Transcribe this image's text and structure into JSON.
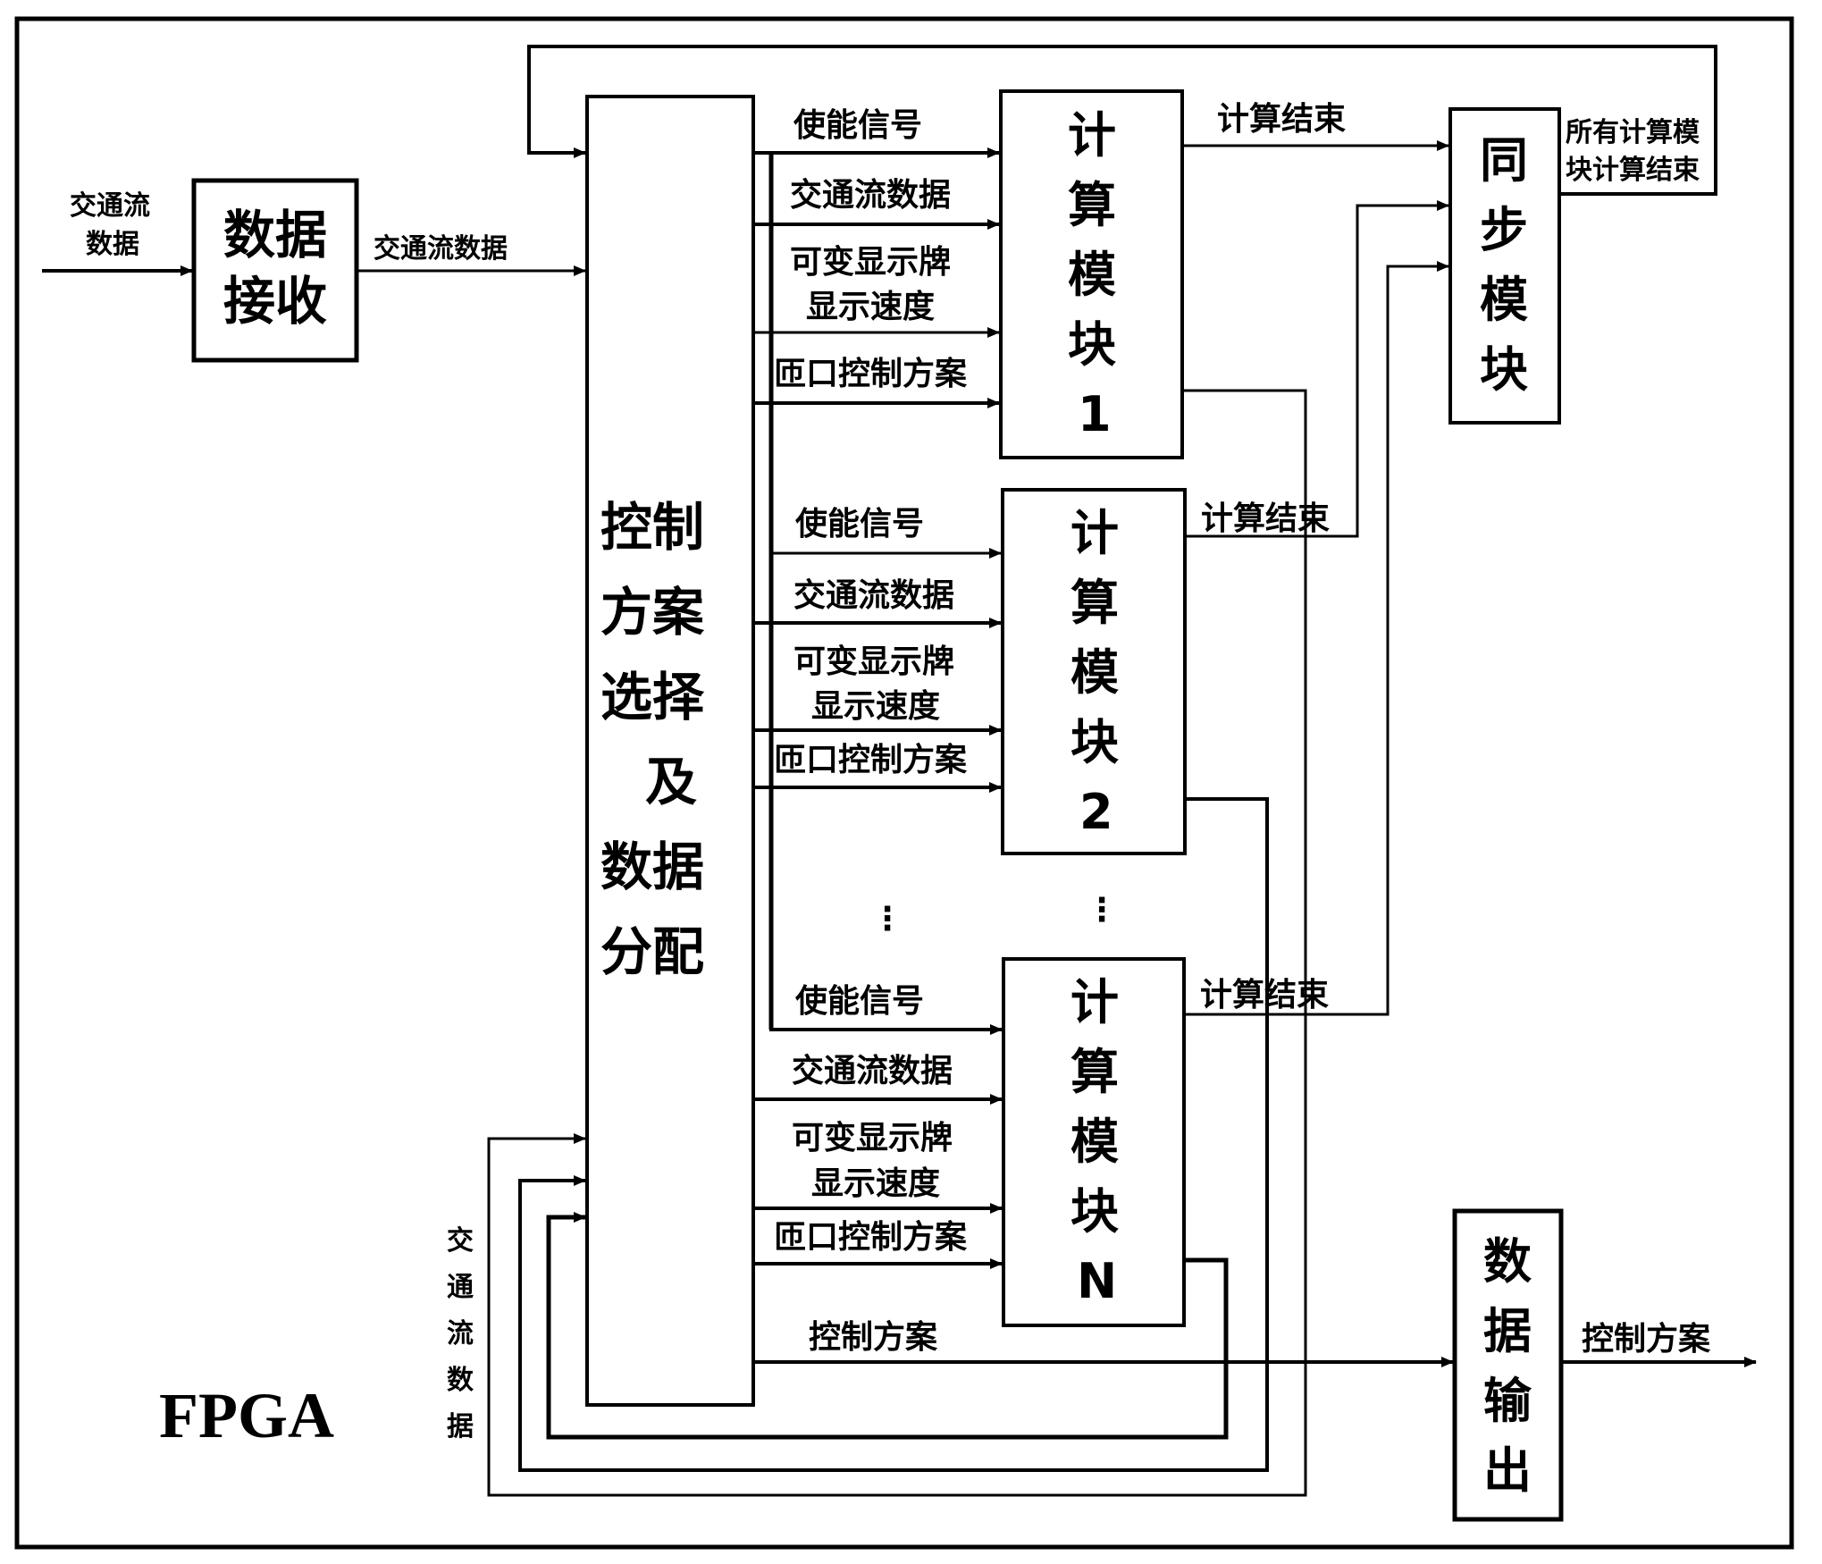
{
  "diagram": {
    "container_label": "FPGA",
    "input_label": [
      "交通流",
      "数据"
    ],
    "blocks": {
      "data_receive": [
        "数据",
        "接收"
      ],
      "control_select": [
        "控制",
        "方案",
        "选择",
        "及",
        "数据",
        "分配"
      ],
      "sync": [
        "同",
        "步",
        "模",
        "块"
      ],
      "data_output": [
        "数",
        "据",
        "输",
        "出"
      ],
      "compute_modules": [
        {
          "chars": [
            "计",
            "算",
            "模",
            "块"
          ],
          "id": "1"
        },
        {
          "chars": [
            "计",
            "算",
            "模",
            "块"
          ],
          "id": "2"
        },
        {
          "chars": [
            "计",
            "算",
            "模",
            "块"
          ],
          "id": "N"
        }
      ]
    },
    "edge_labels": {
      "traffic_data": "交通流数据",
      "enable_signal": "使能信号",
      "vms_speed": [
        "可变显示牌",
        "显示速度"
      ],
      "ramp_plan": "匝口控制方案",
      "compute_done": "计算结束",
      "all_done": [
        "所有计算模",
        "块计算结束"
      ],
      "control_plan": "控制方案",
      "output_plan": "控制方案",
      "feedback_traffic": [
        "交",
        "通",
        "流",
        "数",
        "据"
      ]
    },
    "ellipsis": "⋮"
  }
}
